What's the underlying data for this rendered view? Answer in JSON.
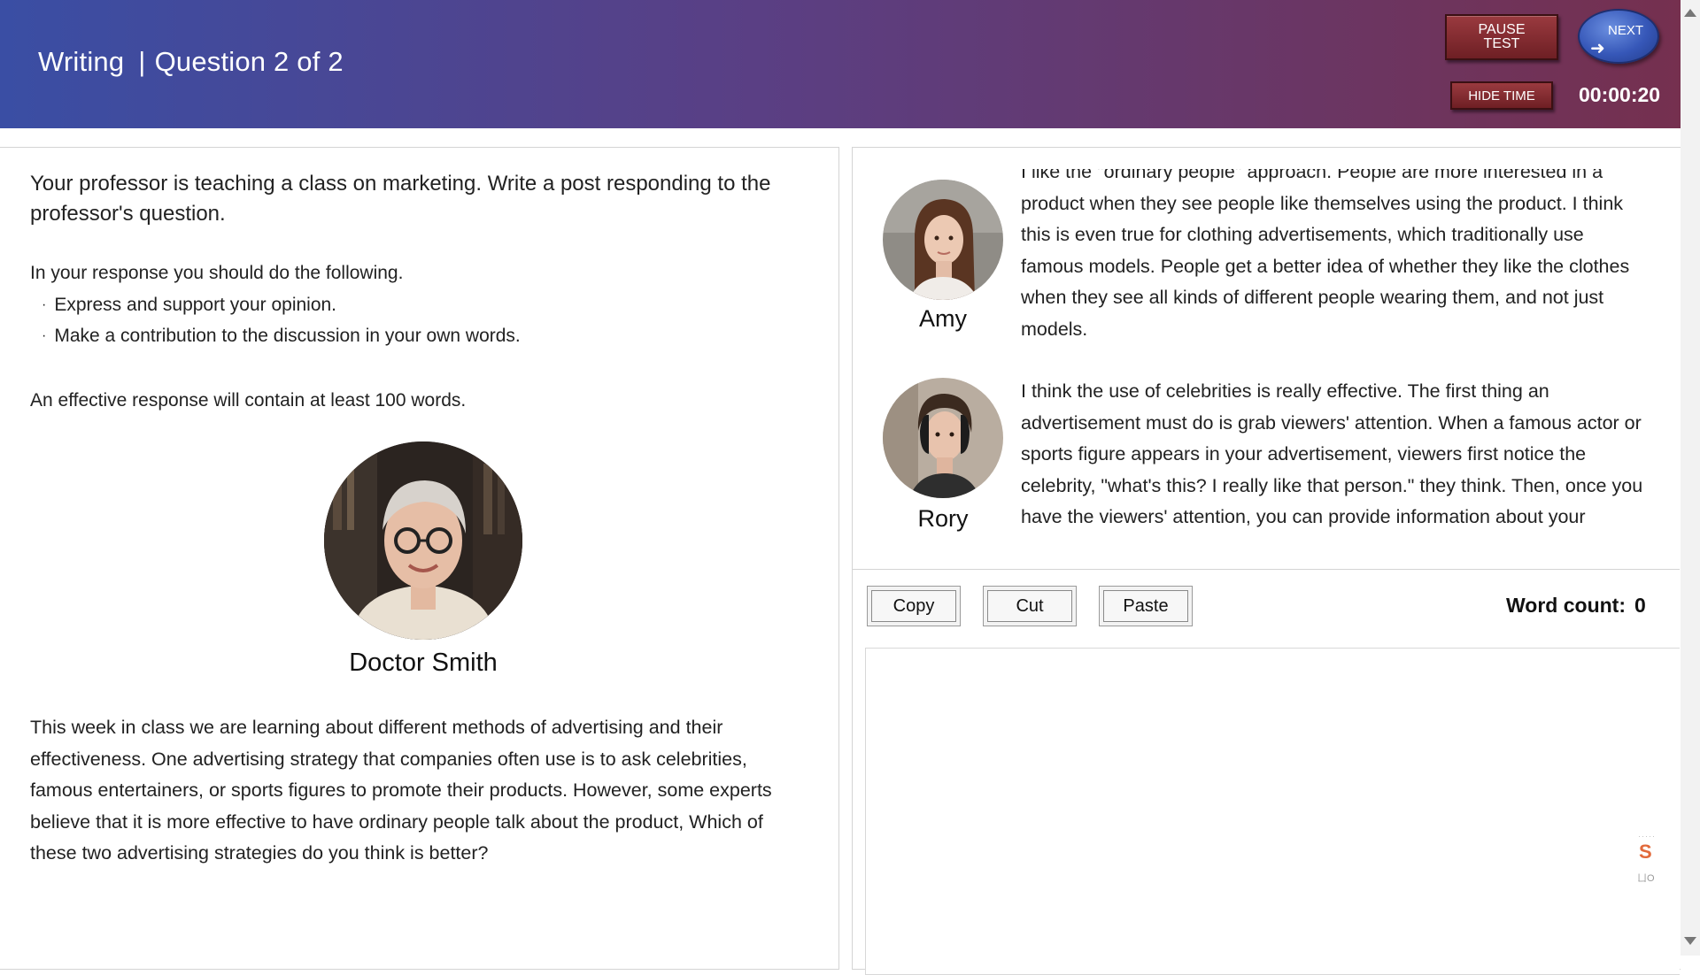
{
  "header": {
    "section": "Writing",
    "separator": "|",
    "question": "Question 2 of 2",
    "pause_label": "PAUSE TEST",
    "next_label": "NEXT",
    "hide_time_label": "HIDE TIME",
    "timer": "00:00:20"
  },
  "prompt": {
    "intro": "Your professor is teaching a class on marketing. Write a post responding to the professor's question.",
    "instructions_heading": "In your response you should do the following.",
    "instructions": [
      "Express and support your opinion.",
      "Make a contribution to the discussion in your own words."
    ],
    "min_words": "An effective response will contain at least 100 words.",
    "professor_name": "Doctor Smith",
    "professor_text": "This week in class we are learning about different methods of advertising and their effectiveness. One advertising strategy that companies often use is to ask celebrities, famous entertainers, or sports figures to promote their products. However, some experts believe that it is more effective to have ordinary people talk about the product, Which of these two advertising strategies do you think is better?"
  },
  "posts": [
    {
      "name": "Amy",
      "text": "I like the \"ordinary people\" approach. People are more interested in a product when they see people like themselves using the product. I think this is even true for clothing advertisements, which traditionally use famous models. People get a better idea of whether they like the clothes when they see all kinds of different people wearing them, and not just models."
    },
    {
      "name": "Rory",
      "text": "I think the use of celebrities is really effective. The first thing an advertisement must do is grab viewers' attention. When a famous actor or sports figure appears in your advertisement, viewers first notice the celebrity, \"what's this? I really like that person.\" they think. Then, once you have the viewers' attention, you can provide information about your"
    }
  ],
  "editor": {
    "copy_label": "Copy",
    "cut_label": "Cut",
    "paste_label": "Paste",
    "word_count_label": "Word count:",
    "word_count_value": "0",
    "response_text": ""
  },
  "widget": {
    "logo": "S",
    "sub": "ㄩO"
  },
  "colors": {
    "header_start": "#3a4ea4",
    "header_end": "#75304f",
    "pause_button": "#8a2f35",
    "next_button": "#3657b8"
  },
  "icons": [
    "arrow-right-icon",
    "scroll-up-icon",
    "scroll-down-icon"
  ]
}
